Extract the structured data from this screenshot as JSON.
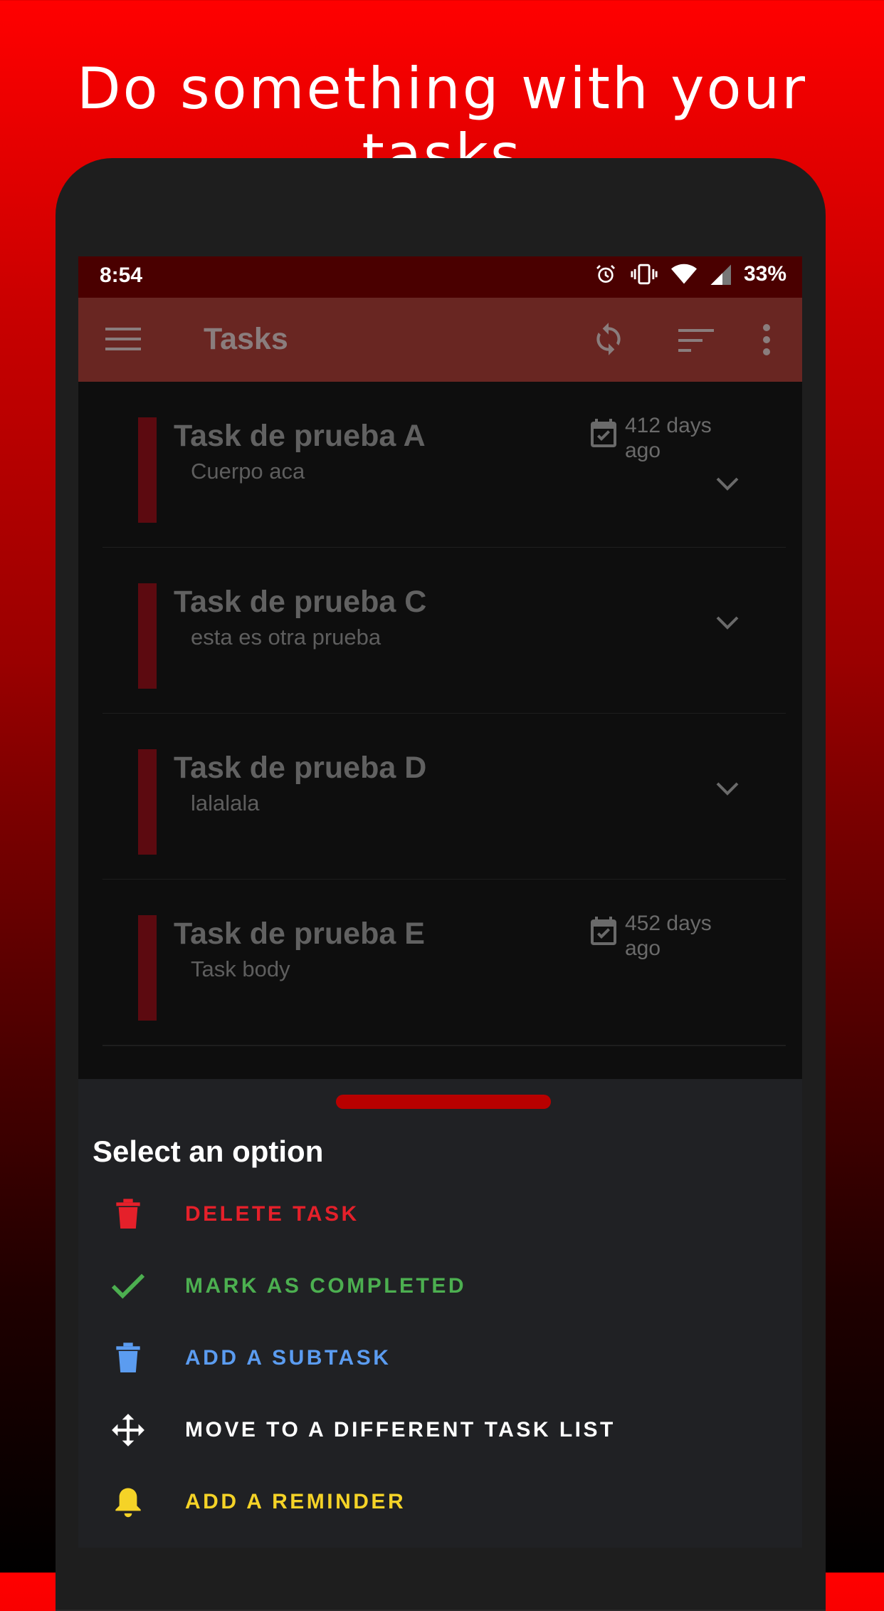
{
  "headline": "Do something with your tasks",
  "status_bar": {
    "time": "8:54",
    "battery": "33%",
    "icons": [
      "alarm-icon",
      "vibrate-icon",
      "wifi-icon",
      "signal-icon"
    ]
  },
  "app_bar": {
    "title": "Tasks",
    "icons": [
      "menu-icon",
      "sync-icon",
      "sort-icon",
      "more-icon"
    ]
  },
  "tasks": [
    {
      "title": "Task de prueba A",
      "body": "Cuerpo aca",
      "due": "412 days ago",
      "has_subtasks": true
    },
    {
      "title": "Task de prueba C",
      "body": "esta es otra prueba",
      "due": "",
      "has_subtasks": true
    },
    {
      "title": "Task de prueba D",
      "body": "lalalala",
      "due": "",
      "has_subtasks": true
    },
    {
      "title": "Task de prueba E",
      "body": "Task body",
      "due": "452 days ago",
      "has_subtasks": false
    }
  ],
  "sheet": {
    "title": "Select an option",
    "options": [
      {
        "label": "DELETE TASK",
        "icon": "trash-icon",
        "color": "#e5202a"
      },
      {
        "label": "MARK AS COMPLETED",
        "icon": "check-icon",
        "color": "#4caf50"
      },
      {
        "label": "ADD A SUBTASK",
        "icon": "trash-icon",
        "color": "#5b9cf0"
      },
      {
        "label": "MOVE TO A DIFFERENT TASK LIST",
        "icon": "move-icon",
        "color": "#ffffff"
      },
      {
        "label": "ADD A REMINDER",
        "icon": "bell-icon",
        "color": "#f5d327"
      }
    ]
  },
  "colors": {
    "accent": "#ff0000",
    "status_bar": "#4a0000",
    "app_bar": "#692622",
    "task_marker": "#5c0a10",
    "sheet_handle": "#b80000",
    "sheet_bg": "#202124"
  }
}
